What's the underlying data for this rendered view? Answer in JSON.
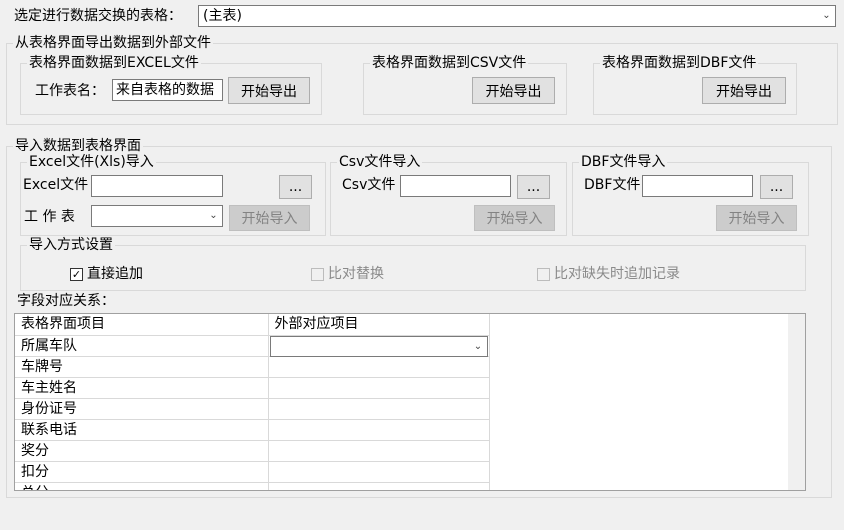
{
  "table_select": {
    "label": "选定进行数据交换的表格：",
    "value": "(主表)"
  },
  "export": {
    "title": "从表格界面导出数据到外部文件",
    "excel": {
      "title": "表格界面数据到EXCEL文件",
      "sheet_label": "工作表名：",
      "sheet_value": "来自表格的数据",
      "button": "开始导出"
    },
    "csv": {
      "title": "表格界面数据到CSV文件",
      "button": "开始导出"
    },
    "dbf": {
      "title": "表格界面数据到DBF文件",
      "button": "开始导出"
    }
  },
  "import": {
    "title": "导入数据到表格界面",
    "excel": {
      "title": "Excel文件(Xls)导入",
      "file_label": "Excel文件",
      "file_value": "",
      "browse": "...",
      "sheet_label": "工 作 表",
      "sheet_value": "",
      "button": "开始导入"
    },
    "csv": {
      "title": "Csv文件导入",
      "file_label": "Csv文件",
      "file_value": "",
      "browse": "...",
      "button": "开始导入"
    },
    "dbf": {
      "title": "DBF文件导入",
      "file_label": "DBF文件",
      "file_value": "",
      "browse": "...",
      "button": "开始导入"
    },
    "mode": {
      "title": "导入方式设置",
      "option1": "直接追加",
      "option1_checked": true,
      "option2": "比对替换",
      "option2_checked": false,
      "option3": "比对缺失时追加记录",
      "option3_checked": false
    }
  },
  "mapping": {
    "title": "字段对应关系：",
    "headers": [
      "表格界面项目",
      "外部对应项目"
    ],
    "rows": [
      "所属车队",
      "车牌号",
      "车主姓名",
      "身份证号",
      "联系电话",
      "奖分",
      "扣分",
      "总分"
    ],
    "selected_value": ""
  },
  "icons": {
    "dropdown": "chevron-down-icon",
    "check": "checkmark-icon"
  }
}
